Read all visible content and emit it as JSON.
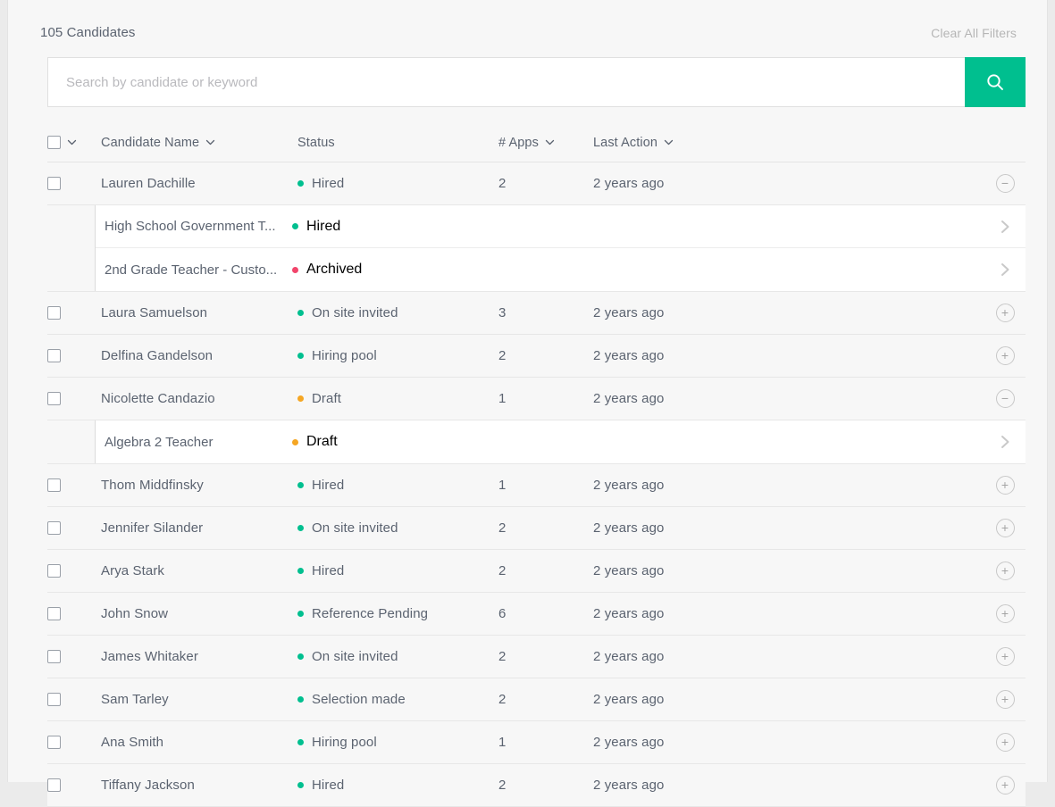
{
  "header": {
    "count_label": "105 Candidates",
    "clear_filters": "Clear All Filters"
  },
  "search": {
    "placeholder": "Search by candidate or keyword",
    "value": "",
    "button_icon": "search-icon"
  },
  "colors": {
    "accent": "#00bf8f",
    "status_green": "#00bf8f",
    "status_orange": "#f5a623",
    "status_pink": "#f2456b",
    "text": "#5b6370",
    "muted": "#b6b6b6",
    "row_bg": "#f7f7f7",
    "subrow_bg": "#ffffff",
    "border": "#e7e7e7"
  },
  "table": {
    "columns": [
      {
        "key": "select",
        "label": "",
        "sortable": true
      },
      {
        "key": "name",
        "label": "Candidate Name",
        "sortable": true
      },
      {
        "key": "status",
        "label": "Status",
        "sortable": false
      },
      {
        "key": "apps",
        "label": "# Apps",
        "sortable": true
      },
      {
        "key": "last_action",
        "label": "Last Action",
        "sortable": true
      }
    ],
    "rows": [
      {
        "name": "Lauren Dachille",
        "status": "Hired",
        "status_color": "#00bf8f",
        "apps": "2",
        "last_action": "2 years ago",
        "expanded": true,
        "toggle": "−",
        "children": [
          {
            "name": "High School Government T...",
            "status": "Hired",
            "status_color": "#00bf8f"
          },
          {
            "name": "2nd Grade Teacher - Custo...",
            "status": "Archived",
            "status_color": "#f2456b"
          }
        ]
      },
      {
        "name": "Laura Samuelson",
        "status": "On site invited",
        "status_color": "#00bf8f",
        "apps": "3",
        "last_action": "2 years ago",
        "expanded": false,
        "toggle": "+",
        "children": []
      },
      {
        "name": "Delfina Gandelson",
        "status": "Hiring pool",
        "status_color": "#00bf8f",
        "apps": "2",
        "last_action": "2 years ago",
        "expanded": false,
        "toggle": "+",
        "children": []
      },
      {
        "name": "Nicolette Candazio",
        "status": "Draft",
        "status_color": "#f5a623",
        "apps": "1",
        "last_action": "2 years ago",
        "expanded": true,
        "toggle": "−",
        "children": [
          {
            "name": "Algebra 2 Teacher",
            "status": "Draft",
            "status_color": "#f5a623"
          }
        ]
      },
      {
        "name": "Thom Middfinsky",
        "status": "Hired",
        "status_color": "#00bf8f",
        "apps": "1",
        "last_action": "2 years ago",
        "expanded": false,
        "toggle": "+",
        "children": []
      },
      {
        "name": "Jennifer Silander",
        "status": "On site invited",
        "status_color": "#00bf8f",
        "apps": "2",
        "last_action": "2 years ago",
        "expanded": false,
        "toggle": "+",
        "children": []
      },
      {
        "name": "Arya Stark",
        "status": "Hired",
        "status_color": "#00bf8f",
        "apps": "2",
        "last_action": "2 years ago",
        "expanded": false,
        "toggle": "+",
        "children": []
      },
      {
        "name": "John Snow",
        "status": "Reference Pending",
        "status_color": "#00bf8f",
        "apps": "6",
        "last_action": "2 years ago",
        "expanded": false,
        "toggle": "+",
        "children": []
      },
      {
        "name": "James Whitaker",
        "status": "On site invited",
        "status_color": "#00bf8f",
        "apps": "2",
        "last_action": "2 years ago",
        "expanded": false,
        "toggle": "+",
        "children": []
      },
      {
        "name": "Sam Tarley",
        "status": "Selection made",
        "status_color": "#00bf8f",
        "apps": "2",
        "last_action": "2 years ago",
        "expanded": false,
        "toggle": "+",
        "children": []
      },
      {
        "name": "Ana Smith",
        "status": "Hiring pool",
        "status_color": "#00bf8f",
        "apps": "1",
        "last_action": "2 years ago",
        "expanded": false,
        "toggle": "+",
        "children": []
      },
      {
        "name": "Tiffany Jackson",
        "status": "Hired",
        "status_color": "#00bf8f",
        "apps": "2",
        "last_action": "2 years ago",
        "expanded": false,
        "toggle": "+",
        "children": []
      }
    ]
  }
}
